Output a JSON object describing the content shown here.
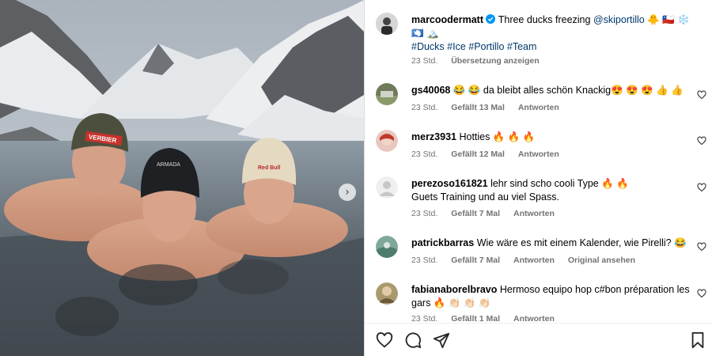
{
  "post": {
    "author": "marcoodermatt",
    "caption_lines": [
      "Three ducks freezing",
      "@skiportillo",
      "🐥 🇨🇱 ❄️",
      "🇦🇶 🏔️"
    ],
    "hashtags": "#Ducks #Ice #Portillo #Team",
    "time": "23 Std.",
    "translate_label": "Übersetzung anzeigen",
    "verified": true
  },
  "comments": [
    {
      "username": "gs40068",
      "text": "😂 😂 da bleibt alles schön Knackig😍 😍 😍 👍 👍",
      "time": "23 Std.",
      "likes": "Gefällt 13 Mal",
      "reply": "Antworten"
    },
    {
      "username": "merz3931",
      "text": "Hotties 🔥 🔥 🔥",
      "time": "23 Std.",
      "likes": "Gefällt 12 Mal",
      "reply": "Antworten"
    },
    {
      "username": "perezoso161821",
      "text": "lehr sind scho cooli Type 🔥 🔥",
      "text2": "Guets Training und au viel Spass.",
      "time": "23 Std.",
      "likes": "Gefällt 7 Mal",
      "reply": "Antworten"
    },
    {
      "username": "patrickbarras",
      "text": "Wie wäre es mit einem Kalender, wie Pirelli? 😂",
      "time": "23 Std.",
      "likes": "Gefällt 7 Mal",
      "reply": "Antworten",
      "original": "Original ansehen"
    },
    {
      "username": "fabianaborelbravo",
      "text": "Hermoso equipo hop c#bon préparation les",
      "text2": "gars 🔥 👏🏻 👏🏻 👏🏻",
      "time": "23 Std.",
      "likes": "Gefällt 1 Mal",
      "reply": "Antworten"
    }
  ],
  "photo": {
    "beanies": [
      "VERBIER",
      "ARMADA",
      "Red Bull"
    ]
  },
  "icons": {
    "like": "heart-outline-icon",
    "comment": "speech-bubble-icon",
    "share": "paper-plane-icon",
    "save": "bookmark-icon",
    "next": "chevron-right-icon",
    "verified": "verified-badge-icon"
  },
  "colors": {
    "link": "#00376b",
    "meta": "#737373",
    "verified": "#0095f6"
  }
}
